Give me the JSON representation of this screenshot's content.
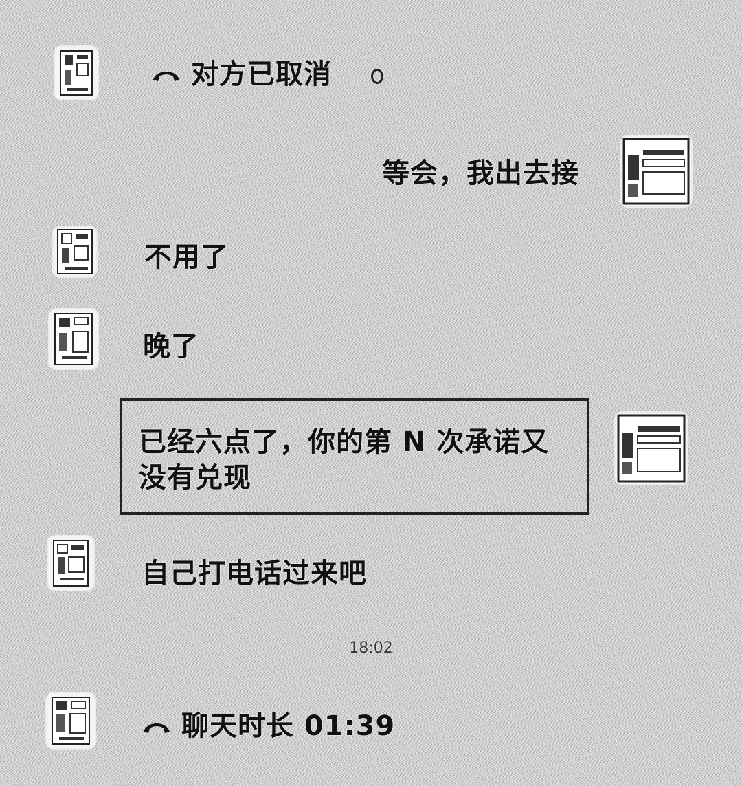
{
  "messages": {
    "m1": {
      "text": "对方已取消",
      "icon": "phone-hangup-icon"
    },
    "m2": {
      "text": "等会，我出去接"
    },
    "m3": {
      "text": "不用了"
    },
    "m4": {
      "text": "晚了"
    },
    "m5": {
      "text": "已经六点了，你的第 N 次承诺又没有兑现"
    },
    "m6": {
      "text": "自己打电话过来吧"
    },
    "m7": {
      "text": "聊天时长 01:39",
      "icon": "phone-hangup-icon"
    }
  },
  "timestamp": "18:02"
}
